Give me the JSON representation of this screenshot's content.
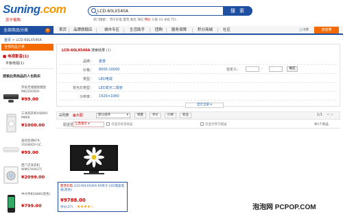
{
  "header": {
    "logo_text_1": "Sun",
    "logo_text_2": "ing",
    "logo_text_3": ".com",
    "logo_sub": "苏宁易购",
    "search_value": "LCD-60LX540A",
    "search_button": "搜 索",
    "hot_words": [
      "热门搜索：",
      "苏宁彩电",
      "夏普",
      "索尼",
      "海信",
      "三星",
      "LG",
      "长虹",
      "TCL"
    ],
    "hot_highlight": "特价"
  },
  "nav": {
    "all_categories": "全部商品分类",
    "items": [
      "首页",
      "品牌旗舰店",
      "城市专区",
      "生活助手",
      "团购",
      "服务保障",
      "积分商城",
      "社区"
    ],
    "cart_count": "0件",
    "cart_button": "去结算"
  },
  "breadcrumb": {
    "home": "首页",
    "sep": ">",
    "current": "LCD-60LX540A"
  },
  "sidebar": {
    "header": "全部商品分类",
    "category": "■ 电视影音(1)",
    "subcategory": "平板电视(1)",
    "viewed_title": "搜索此类商品的人也购买",
    "products": [
      {
        "name": "罗技无线键盘键鼠MK220(920-",
        "price": "¥99.00"
      },
      {
        "name": "三洋洗衣机XQB60-M806",
        "price": "¥1000.00"
      },
      {
        "name": "美的空调KFR-35GW/DY-GC",
        "price": "¥99.00"
      },
      {
        "name": "西门子洗衣机WM07X061TI",
        "price": "¥2099.00"
      },
      {
        "name": "中兴手机U880(黑色)",
        "price": "¥799.00"
      }
    ]
  },
  "filter": {
    "keyword_label": "LCD-60LX540A",
    "keyword_rest": "搜索结果",
    "keyword_count": "(1)",
    "rows": [
      {
        "label": "品牌：",
        "value": "夏普"
      },
      {
        "label": "价格：",
        "value": "8000-10000"
      },
      {
        "label": "类型：",
        "value": "LED电视"
      },
      {
        "label": "背光灯类型：",
        "value": "LED发光二极管"
      },
      {
        "label": "分辨率：",
        "value": "1920×1080"
      }
    ],
    "price_range_label": "自定义：",
    "price_ok": "确定",
    "more_options": "显示全部 ▾"
  },
  "sortbar": {
    "list": "列表",
    "large": "大图",
    "sort_select": "默认排序",
    "sales": "销量",
    "reviews": "评价",
    "price": "价格",
    "new": "新品",
    "page_info": "1/1",
    "arrows": "< >"
  },
  "shipbar": {
    "ship_to": "配送至",
    "city": "江苏南京 ▾",
    "check1_label": "仅显示有货商品",
    "check2_label": "仅显示苏宁配送",
    "total": "共1个商品"
  },
  "product": {
    "brand_name": "夏普彩电",
    "name": "LCD-60LX540A 60英寸 LED液晶电视(黑色)",
    "price": "¥9788.00",
    "review_label": "评价(27)",
    "stars": "★★★★☆"
  },
  "watermark": "泡泡网 PCPOP.COM",
  "colors": {
    "brand_blue": "#1e4fa0",
    "accent_orange": "#f36a00",
    "price_red": "#cc0000"
  }
}
